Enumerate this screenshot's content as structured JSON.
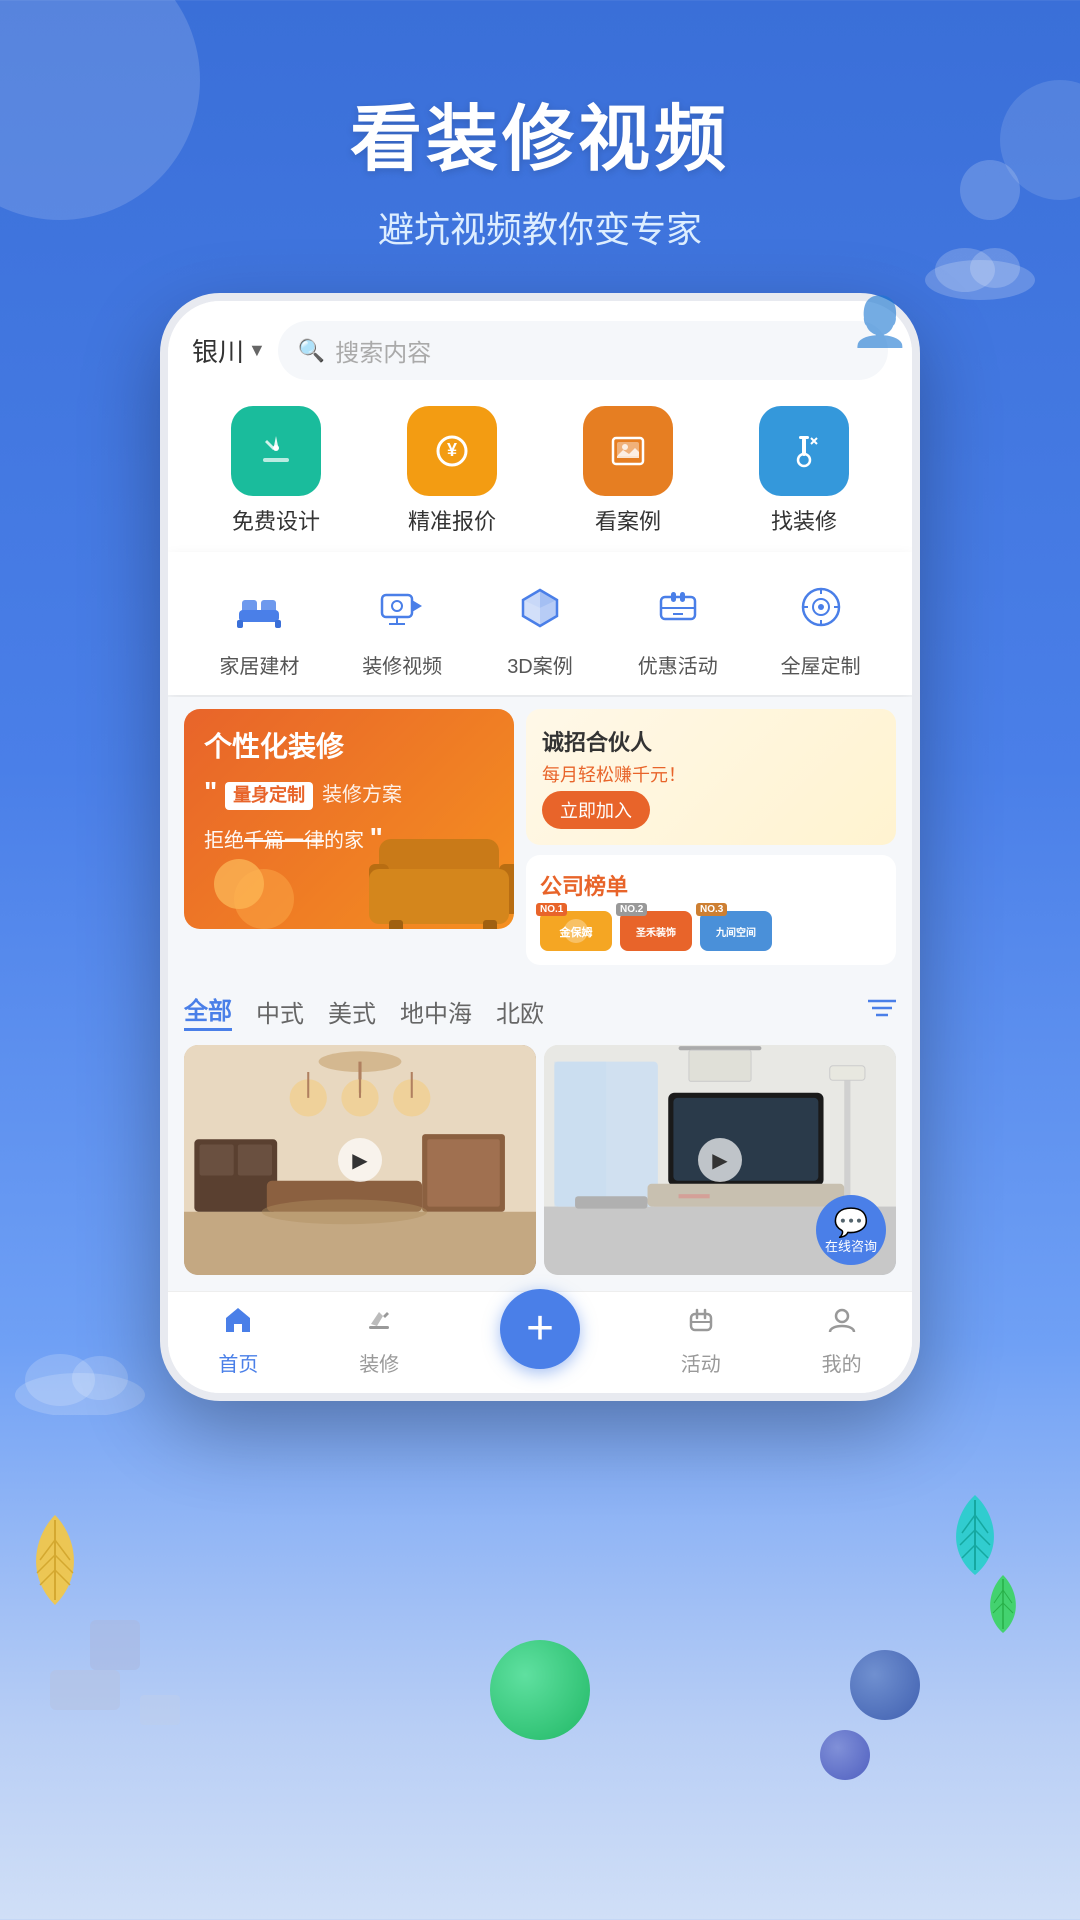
{
  "hero": {
    "title": "看装修视频",
    "subtitle": "避坑视频教你变专家"
  },
  "search": {
    "city": "银川",
    "placeholder": "搜索内容"
  },
  "quick_nav": {
    "items": [
      {
        "label": "免费设计",
        "icon": "✏️",
        "color": "green"
      },
      {
        "label": "精准报价",
        "icon": "¥",
        "color": "orange"
      },
      {
        "label": "看案例",
        "icon": "🖼️",
        "color": "amber"
      },
      {
        "label": "找装修",
        "icon": "🔨",
        "color": "blue"
      }
    ]
  },
  "second_nav": {
    "items": [
      {
        "label": "家居建材",
        "icon": "🛋️"
      },
      {
        "label": "装修视频",
        "icon": "📹"
      },
      {
        "label": "3D案例",
        "icon": "📦"
      },
      {
        "label": "优惠活动",
        "icon": "🎁"
      },
      {
        "label": "全屋定制",
        "icon": "📷"
      }
    ]
  },
  "banner_left": {
    "title": "个性化装修",
    "badge": "量身定制",
    "mid_text": "装修方案",
    "sub_text": "拒绝千篇一律的家",
    "quote_open": "““",
    "quote_close": "””"
  },
  "partner_card": {
    "title": "诚招合伙人",
    "subtitle": "每月轻松赚千元！",
    "btn_label": "立即加入"
  },
  "ranking_card": {
    "label": "公司",
    "label_highlight": "榜单",
    "logos": [
      {
        "rank": "NO.1",
        "name": "金保姆"
      },
      {
        "rank": "NO.2",
        "name": "圣禾装饰"
      },
      {
        "rank": "NO.3",
        "name": "九间空间"
      }
    ]
  },
  "style_tabs": {
    "items": [
      {
        "label": "全部",
        "active": true
      },
      {
        "label": "中式"
      },
      {
        "label": "美式"
      },
      {
        "label": "地中海"
      },
      {
        "label": "北欧"
      }
    ]
  },
  "bottom_nav": {
    "items": [
      {
        "label": "首页",
        "icon": "🏠",
        "active": true
      },
      {
        "label": "装修",
        "icon": "✏️",
        "active": false
      },
      {
        "label": "+",
        "is_plus": true
      },
      {
        "label": "活动",
        "icon": "🎁",
        "active": false
      },
      {
        "label": "我的",
        "icon": "👤",
        "active": false
      }
    ]
  },
  "consult": {
    "label": "在线咨询"
  },
  "colors": {
    "primary": "#4a7fe8",
    "orange": "#e8642a",
    "green": "#1abc9c",
    "text_dark": "#333333",
    "bg_light": "#f5f7fa"
  }
}
